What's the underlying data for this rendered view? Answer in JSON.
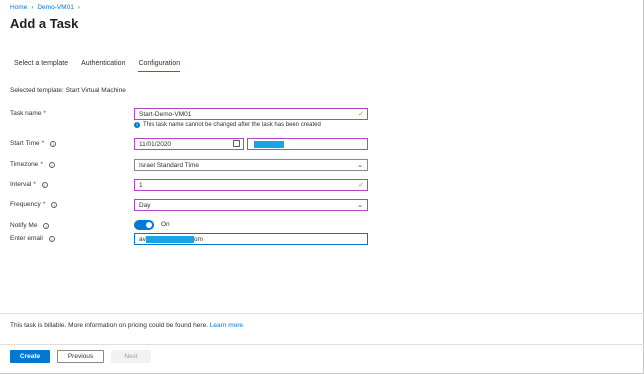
{
  "breadcrumb": {
    "items": [
      "Home",
      "Demo-VM01"
    ]
  },
  "page": {
    "title": "Add a Task"
  },
  "tabs": [
    {
      "label": "Select a template"
    },
    {
      "label": "Authentication"
    },
    {
      "label": "Configuration",
      "active": true
    }
  ],
  "selected_template": "Selected template: Start Virtual Machine",
  "form": {
    "task_name": {
      "label": "Task name",
      "required": true,
      "value": "Start-Demo-VM01",
      "hint": "This task name cannot be changed after the task has been created"
    },
    "start_time": {
      "label": "Start Time",
      "required": true,
      "date": "11/01/2020",
      "time_suffix": ""
    },
    "timezone": {
      "label": "Timezone",
      "required": true,
      "value": "Israel Standard Time"
    },
    "interval": {
      "label": "Interval",
      "required": true,
      "value": "1"
    },
    "frequency": {
      "label": "Frequency",
      "required": true,
      "value": "Day"
    },
    "notify_me": {
      "label": "Notify Me",
      "state": "On",
      "enabled": true
    },
    "email": {
      "label": "Enter email",
      "value_prefix": "av",
      "value_suffix": "om"
    }
  },
  "footer": {
    "note": "This task is billable. More information on pricing could be found here.",
    "link": "Learn more"
  },
  "buttons": {
    "create": "Create",
    "previous": "Previous",
    "next": "Next"
  },
  "colors": {
    "accent": "#0078d4",
    "invalid_border": "#b146c2",
    "success": "#6bb700",
    "required": "#a4262c"
  }
}
